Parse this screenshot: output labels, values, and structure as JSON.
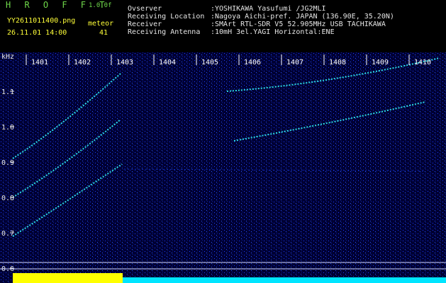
{
  "header": {
    "title": "H R O F F T",
    "version": "1.0.0f",
    "filename": "YY2611011400.png",
    "meteor_label": "meteor",
    "datetime": "26.11.01 14:00",
    "meteor_count": "41"
  },
  "info": [
    {
      "label": "Ovserver",
      "value": ":YOSHIKAWA Yasufumi /JG2MLI"
    },
    {
      "label": "Receiving Location",
      "value": ":Nagoya Aichi-pref. JAPAN (136.90E, 35.20N)"
    },
    {
      "label": "Receiver",
      "value": ":SMArt RTL-SDR V5 52.905MHz USB TACHIKAWA"
    },
    {
      "label": "Receiving Antenna",
      "value": ":10mH 3el.YAGI Horizontal:ENE"
    }
  ],
  "chart_data": {
    "type": "heatmap",
    "ylabel": "kHz",
    "y_ticks": [
      "1.1",
      "1.0",
      "0.9",
      "0.8",
      "0.7",
      "0.6"
    ],
    "x_ticks": [
      "1401",
      "1402",
      "1403",
      "1404",
      "1405",
      "1406",
      "1407",
      "1408",
      "1409",
      "1410"
    ],
    "colors": {
      "background": "#000033",
      "noise": "#1a3cff",
      "signal": "#33ffff",
      "level_bar_yellow": "#ffff00",
      "level_bar_cyan": "#00e5ff"
    }
  }
}
